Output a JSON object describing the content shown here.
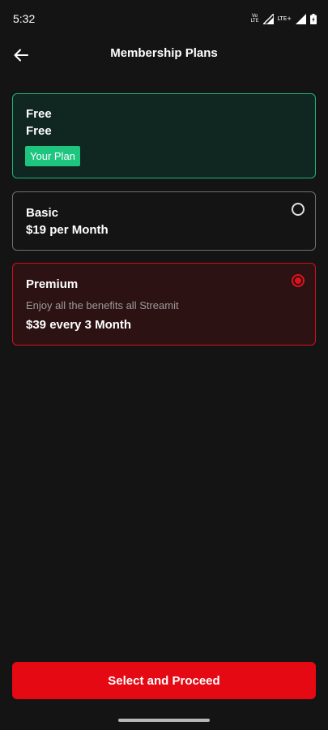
{
  "status_bar": {
    "time": "5:32",
    "volte_top": "Vo",
    "volte_bottom": "LTE",
    "lte_label": "LTE+",
    "icons": [
      "volte-icon",
      "signal-icon",
      "lte-signal-icon",
      "battery-icon"
    ]
  },
  "header": {
    "title": "Membership Plans",
    "back_icon": "arrow-left-icon"
  },
  "plans": [
    {
      "name": "Free",
      "price": "Free",
      "badge": "Your Plan",
      "current": true
    },
    {
      "name": "Basic",
      "price": "$19 per Month",
      "selected": false
    },
    {
      "name": "Premium",
      "description": "Enjoy all the benefits all Streamit",
      "price": "$39 every 3 Month",
      "selected": true
    }
  ],
  "footer": {
    "proceed_label": "Select and Proceed"
  },
  "colors": {
    "background": "#141414",
    "accent_red": "#e50914",
    "current_plan_green": "#1ec57f",
    "current_plan_border": "#22b07d",
    "premium_card_bg": "#2d1214"
  }
}
